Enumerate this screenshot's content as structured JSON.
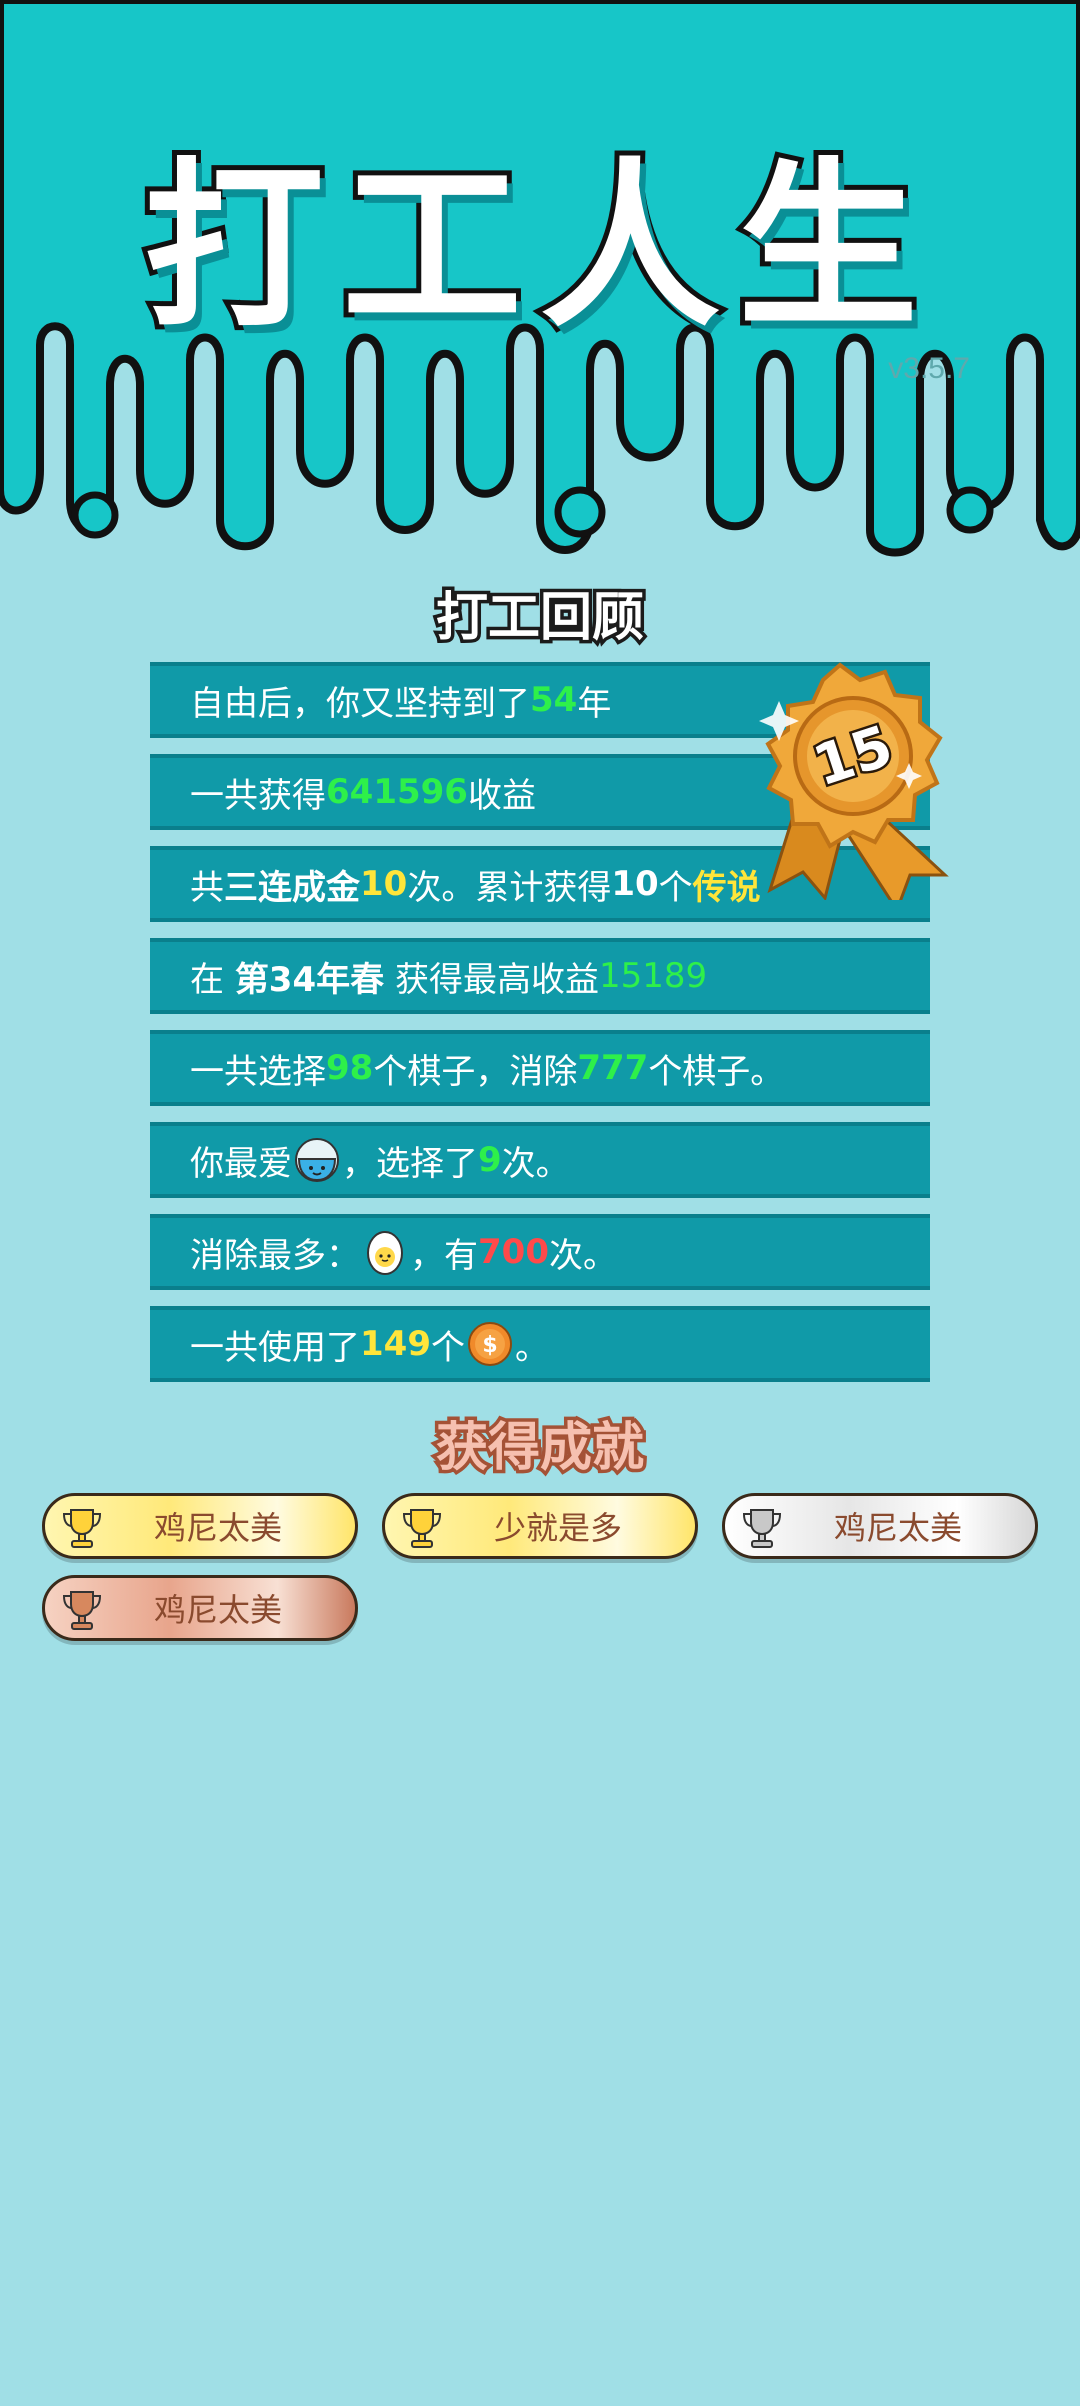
{
  "header": {
    "game_title": "打工人生",
    "version": "v3.5.7"
  },
  "review": {
    "title": "打工回顾",
    "medal_value": "15",
    "rows": [
      {
        "a": "自由后，你又坚持到了",
        "b": "54",
        "c": "年"
      },
      {
        "a": "一共获得",
        "b": "641596",
        "c": "收益"
      },
      {
        "a": "共",
        "b": "三连成金",
        "c": "10",
        "d": "次。累计获得",
        "e": "10",
        "f": "个",
        "g": "传说"
      },
      {
        "a": "在 ",
        "b": "第34年春",
        "c": " 获得最高收益",
        "d": "15189"
      },
      {
        "a": "一共选择",
        "b": "98",
        "c": "个棋子，消除",
        "d": "777",
        "e": "个棋子。"
      },
      {
        "a": "你最爱",
        "b": "，选择了",
        "c": "9",
        "d": "次。"
      },
      {
        "a": "消除最多：",
        "b": "，有",
        "c": "700",
        "d": "次。"
      },
      {
        "a": "一共使用了",
        "b": "149",
        "c": "个",
        "d": "。"
      }
    ]
  },
  "achievements": {
    "title": "获得成就",
    "items": [
      {
        "label": "鸡尼太美",
        "tier": "gold"
      },
      {
        "label": "少就是多",
        "tier": "gold"
      },
      {
        "label": "鸡尼太美",
        "tier": "silver"
      },
      {
        "label": "鸡尼太美",
        "tier": "bronze"
      }
    ]
  },
  "colors": {
    "top_teal": "#17c6c8",
    "background": "#a0dfe6",
    "row_bg": "#109aa8",
    "highlight_green": "#2ef04a",
    "highlight_yellow": "#ffe53a",
    "highlight_red": "#ff4a4a"
  },
  "icons": {
    "medal": "ribbon-medal-icon",
    "favorite_piece": "rice-bowl-icon",
    "most_eliminated": "egg-icon",
    "currency": "coin-icon",
    "achievement": "trophy-icon"
  }
}
